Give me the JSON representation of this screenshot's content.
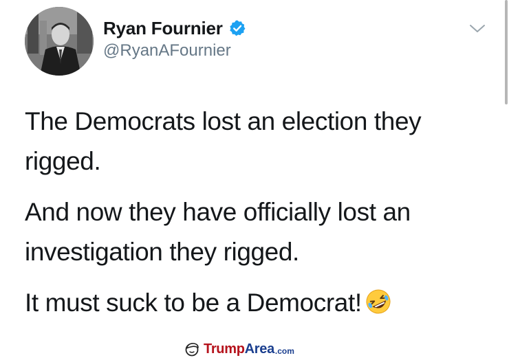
{
  "author": {
    "display_name": "Ryan Fournier",
    "handle": "@RyanAFournier",
    "verified_icon": "verified-badge-icon",
    "avatar": "profile-photo"
  },
  "tweet": {
    "paragraphs": [
      "The Democrats lost an election they rigged.",
      "And now they have officially lost an investigation they rigged.",
      "It must suck to be a Democrat!"
    ],
    "emoji": "rolling-on-floor-laughing-emoji"
  },
  "menu": {
    "icon": "chevron-down-icon"
  },
  "watermark": {
    "brand_part1": "Trump",
    "brand_part2": "Area",
    "brand_suffix": ".com",
    "icon": "trump-hair-icon"
  },
  "colors": {
    "verified_blue": "#1da1f2",
    "handle_gray": "#657786",
    "text": "#14171a",
    "brand_red": "#b5121b",
    "brand_blue": "#1b3f8f"
  }
}
